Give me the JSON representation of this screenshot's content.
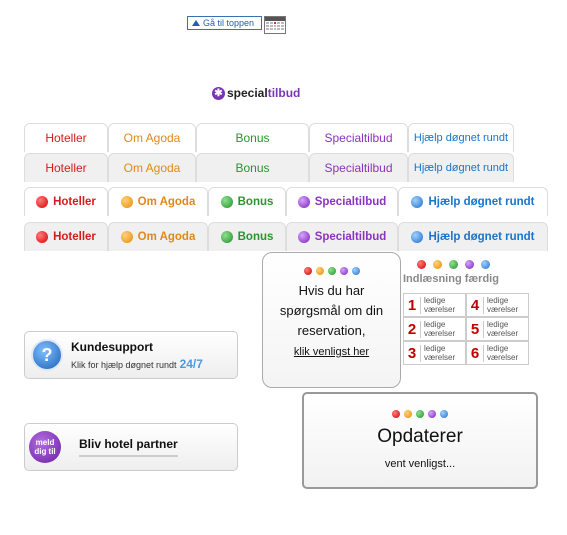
{
  "top_link": {
    "label": "Gå til toppen"
  },
  "special_logo": {
    "star": "✱",
    "part1": "special",
    "part2": "tilbud"
  },
  "tab_rows": [
    {
      "style": "plain",
      "items": [
        {
          "label": "Hoteller",
          "color": "red"
        },
        {
          "label": "Om Agoda",
          "color": "orange"
        },
        {
          "label": "Bonus",
          "color": "green"
        },
        {
          "label": "Specialtilbud",
          "color": "purple"
        },
        {
          "label": "Hjælp døgnet rundt",
          "color": "blue"
        }
      ]
    },
    {
      "style": "grey",
      "items": [
        {
          "label": "Hoteller",
          "color": "red"
        },
        {
          "label": "Om Agoda",
          "color": "orange"
        },
        {
          "label": "Bonus",
          "color": "green"
        },
        {
          "label": "Specialtilbud",
          "color": "purple"
        },
        {
          "label": "Hjælp døgnet rundt",
          "color": "blue"
        }
      ]
    },
    {
      "style": "bold",
      "items": [
        {
          "label": "Hoteller",
          "color": "red"
        },
        {
          "label": "Om Agoda",
          "color": "orange"
        },
        {
          "label": "Bonus",
          "color": "green"
        },
        {
          "label": "Specialtilbud",
          "color": "purple"
        },
        {
          "label": "Hjælp døgnet rundt",
          "color": "blue"
        }
      ]
    },
    {
      "style": "bold-grey",
      "items": [
        {
          "label": "Hoteller",
          "color": "red"
        },
        {
          "label": "Om Agoda",
          "color": "orange"
        },
        {
          "label": "Bonus",
          "color": "green"
        },
        {
          "label": "Specialtilbud",
          "color": "purple"
        },
        {
          "label": "Hjælp døgnet rundt",
          "color": "blue"
        }
      ]
    }
  ],
  "colors": {
    "red": "#d31d1d",
    "orange": "#e0891b",
    "green": "#29952e",
    "purple": "#8b33c0",
    "blue": "#1a74c9"
  },
  "bubble": {
    "line1": "Hvis du har",
    "line2": "spørgsmål om din",
    "line3": "reservation,",
    "link": "klik venligst her"
  },
  "loading": {
    "title": "Indlæsning færdig",
    "rooms": [
      {
        "n": "1",
        "l1": "ledige",
        "l2": "værelser"
      },
      {
        "n": "4",
        "l1": "ledige",
        "l2": "værelser"
      },
      {
        "n": "2",
        "l1": "ledige",
        "l2": "værelser"
      },
      {
        "n": "5",
        "l1": "ledige",
        "l2": "værelser"
      },
      {
        "n": "3",
        "l1": "ledige",
        "l2": "værelser"
      },
      {
        "n": "6",
        "l1": "ledige",
        "l2": "værelser"
      }
    ]
  },
  "support": {
    "icon": "?",
    "title": "Kundesupport",
    "sub": "Klik for hjælp døgnet rundt",
    "hours": "24/7"
  },
  "partner": {
    "badge1": "meld",
    "badge2": "dig til",
    "label": "Bliv hotel partner"
  },
  "updating": {
    "title": "Opdaterer",
    "sub": "vent venligst..."
  }
}
